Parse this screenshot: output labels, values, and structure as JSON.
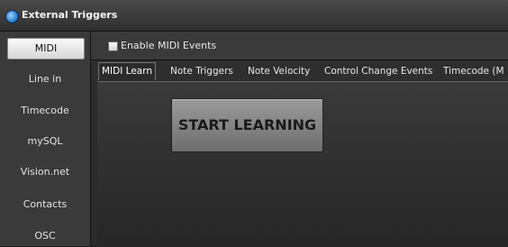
{
  "window": {
    "title": "External Triggers",
    "icon": "app-globe-icon"
  },
  "sidebar": {
    "items": [
      {
        "label": "MIDI",
        "active": true
      },
      {
        "label": "Line in"
      },
      {
        "label": "Timecode"
      },
      {
        "label": "mySQL"
      },
      {
        "label": "Vision.net"
      },
      {
        "label": "Contacts"
      },
      {
        "label": "OSC"
      }
    ]
  },
  "enable": {
    "label": "Enable MIDI Events",
    "checked": false
  },
  "tabs": [
    {
      "label": "MIDI Learn",
      "active": true
    },
    {
      "label": "Note Triggers"
    },
    {
      "label": "Note Velocity"
    },
    {
      "label": "Control Change Events"
    },
    {
      "label": "Timecode (M"
    }
  ],
  "content": {
    "learn_button": "START LEARNING"
  }
}
